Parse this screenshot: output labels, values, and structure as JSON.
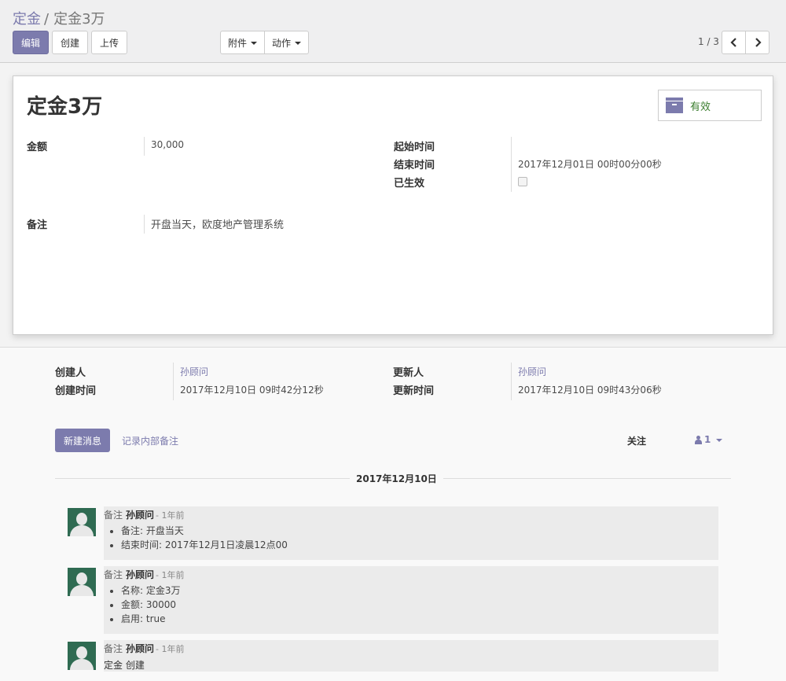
{
  "breadcrumb": {
    "parent": "定金",
    "separator": "/",
    "current": "定金3万"
  },
  "toolbar": {
    "edit": "编辑",
    "create": "创建",
    "upload": "上传",
    "attachment": "附件",
    "action": "动作"
  },
  "pager": {
    "value": "1 / 3"
  },
  "record": {
    "title": "定金3万",
    "active_label": "有效",
    "amount_label": "金额",
    "amount_value": "30,000",
    "start_label": "起始时间",
    "start_value": "",
    "end_label": "结束时间",
    "end_value": "2017年12月01日 00时00分00秒",
    "effective_label": "已生效",
    "effective_checked": false,
    "note_label": "备注",
    "note_value": "开盘当天，欧度地产管理系统"
  },
  "meta": {
    "created_by_label": "创建人",
    "created_by_value": "孙顾问",
    "created_on_label": "创建时间",
    "created_on_value": "2017年12月10日 09时42分12秒",
    "updated_by_label": "更新人",
    "updated_by_value": "孙顾问",
    "updated_on_label": "更新时间",
    "updated_on_value": "2017年12月10日 09时43分06秒"
  },
  "chatter": {
    "new_message": "新建消息",
    "log_note": "记录内部备注",
    "follow": "关注",
    "followers_count": "1",
    "date_separator": "2017年12月10日",
    "messages": [
      {
        "type": "备注",
        "author": "孙顾问",
        "ago": "- 1年前",
        "items": [
          "备注: 开盘当天",
          "结束时间: 2017年12月1日凌晨12点00"
        ]
      },
      {
        "type": "备注",
        "author": "孙顾问",
        "ago": "- 1年前",
        "items": [
          "名称: 定金3万",
          "金额: 30000",
          "启用: true"
        ]
      },
      {
        "type": "备注",
        "author": "孙顾问",
        "ago": "- 1年前",
        "text": "定金 创建"
      }
    ]
  },
  "colors": {
    "primary": "#7c7bad",
    "active_green": "#3a7d2e",
    "avatar_bg": "#2f6b52"
  }
}
